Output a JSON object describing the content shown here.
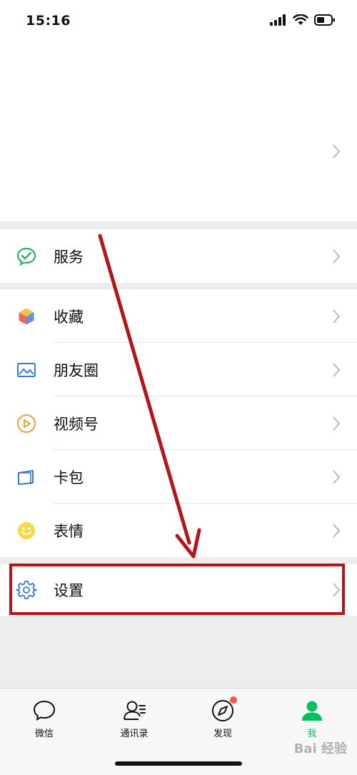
{
  "status_bar": {
    "time": "15:16"
  },
  "menu": {
    "services": {
      "label": "服务"
    },
    "favorites": {
      "label": "收藏"
    },
    "moments": {
      "label": "朋友圈"
    },
    "channels": {
      "label": "视频号"
    },
    "cards": {
      "label": "卡包"
    },
    "stickers": {
      "label": "表情"
    },
    "settings": {
      "label": "设置"
    }
  },
  "tabbar": {
    "tabs": [
      {
        "label": "微信",
        "icon": "chat-bubble-icon",
        "active": false
      },
      {
        "label": "通讯录",
        "icon": "contacts-icon",
        "active": false
      },
      {
        "label": "发现",
        "icon": "compass-icon",
        "active": false,
        "badge": true
      },
      {
        "label": "我",
        "icon": "person-icon",
        "active": true
      }
    ]
  },
  "watermark": "Bai 经验",
  "colors": {
    "accent_green": "#07c160",
    "highlight_red": "#b3151a",
    "badge_red": "#fa5151"
  }
}
